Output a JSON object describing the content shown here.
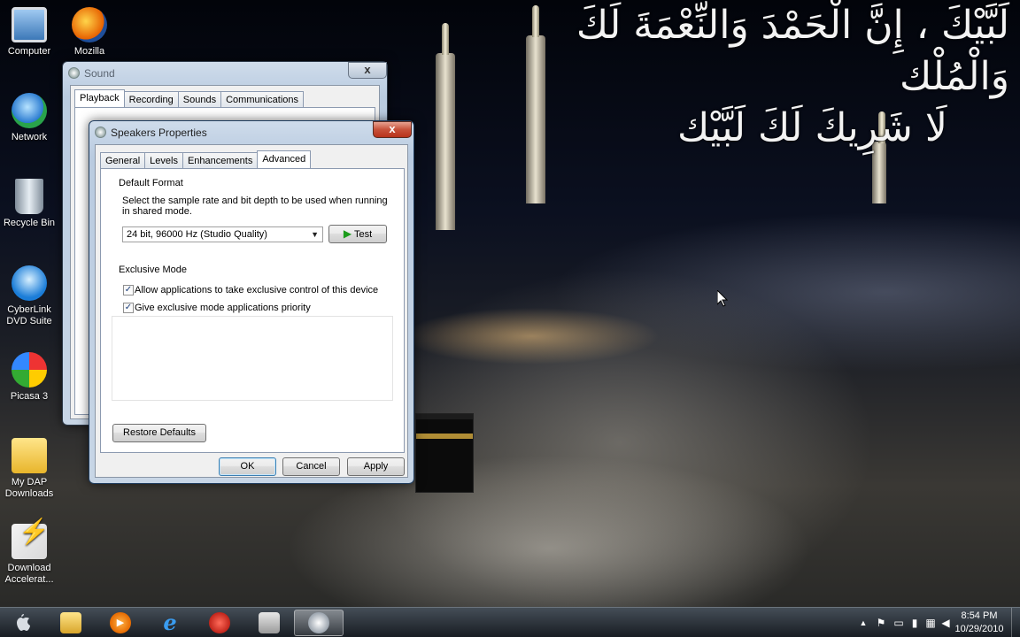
{
  "desktop": {
    "calligraphy_lines": [
      "لَبَّيْكَ ، إِنَّ الْحَمْدَ وَالنِّعْمَةَ لَكَ وَالْمُلْك",
      "لَا شَرِيكَ لَكَ لَبَّيْك"
    ],
    "icons": [
      {
        "label": "Computer",
        "icon": "computer-icon"
      },
      {
        "label": "Mozilla",
        "icon": "firefox-icon"
      },
      {
        "label": "Network",
        "icon": "network-icon"
      },
      {
        "label": "Recycle Bin",
        "icon": "recycle-bin-icon"
      },
      {
        "label": "CyberLink DVD Suite",
        "icon": "cyberlink-icon"
      },
      {
        "label": "Picasa 3",
        "icon": "picasa-icon"
      },
      {
        "label": "My DAP Downloads",
        "icon": "folder-icon"
      },
      {
        "label": "Download Accelerat...",
        "icon": "download-accelerator-icon"
      }
    ]
  },
  "sound_window": {
    "title": "Sound",
    "close": "x",
    "tabs": [
      "Playback",
      "Recording",
      "Sounds",
      "Communications"
    ],
    "active_tab": "Playback"
  },
  "speakers_window": {
    "title": "Speakers Properties",
    "close": "x",
    "tabs": [
      "General",
      "Levels",
      "Enhancements",
      "Advanced"
    ],
    "active_tab": "Advanced",
    "default_format": {
      "heading": "Default Format",
      "description": "Select the sample rate and bit depth to be used when running in shared mode.",
      "selected": "24 bit, 96000 Hz (Studio Quality)",
      "test_button": "Test"
    },
    "exclusive_mode": {
      "heading": "Exclusive Mode",
      "option1": {
        "label": "Allow applications to take exclusive control of this device",
        "checked": true
      },
      "option2": {
        "label": "Give exclusive mode applications priority",
        "checked": true
      }
    },
    "restore_defaults": "Restore Defaults",
    "ok": "OK",
    "cancel": "Cancel",
    "apply": "Apply"
  },
  "taskbar": {
    "pinned": [
      "start-orb-icon",
      "explorer-folder-icon",
      "media-player-icon",
      "internet-explorer-icon",
      "browser-icon",
      "camera-app-icon",
      "sound-control-icon"
    ],
    "clock_time": "8:54 PM",
    "clock_date": "10/29/2010"
  }
}
